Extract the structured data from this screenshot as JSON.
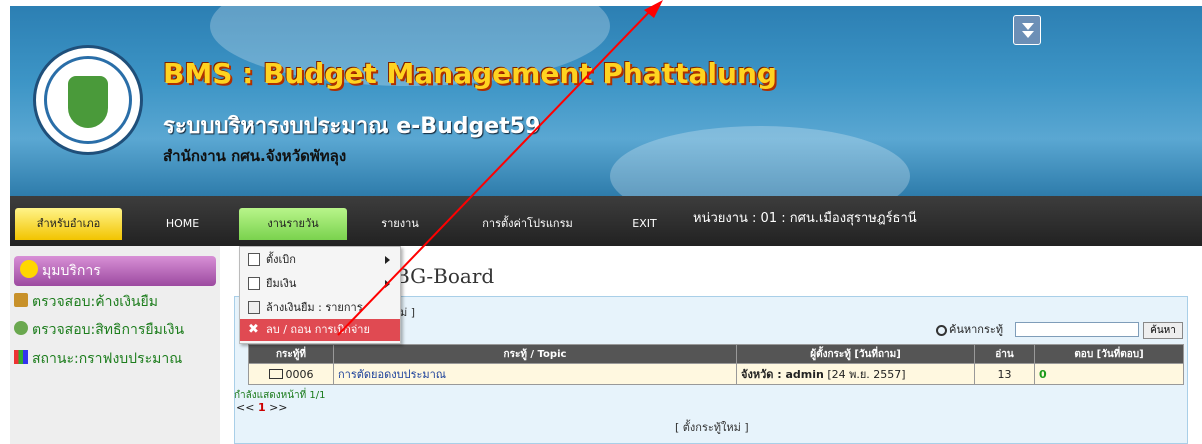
{
  "header": {
    "title_en": "BMS : Budget Management Phattalung",
    "title_th": "ระบบบริหารงบประมาณ e-Budget59",
    "office": "สำนักงาน กศน.จังหวัดพัทลุง",
    "collapse_icon": "double-chevron-down-icon"
  },
  "nav": {
    "items": [
      "สำหรับอำเภอ",
      "HOME",
      "งานรายวัน",
      "รายงาน",
      "การตั้งค่าโปรแกรม",
      "EXIT"
    ],
    "unit_info": "หน่วยงาน : 01 : กศน.เมืองสุราษฎร์ธานี"
  },
  "dropdown": {
    "items": [
      {
        "label": "ตั้งเบิก",
        "icon": "edit-icon",
        "has_submenu": true
      },
      {
        "label": "ยืมเงิน",
        "icon": "document-icon",
        "has_submenu": true
      },
      {
        "label": "ล้างเงินยืม : รายการ",
        "icon": "list-icon",
        "has_submenu": false
      },
      {
        "label": "ลบ / ถอน การเบิกจ่าย",
        "icon": "delete-icon",
        "has_submenu": false
      }
    ]
  },
  "sidebar": {
    "header": "มุมบริการ",
    "items": [
      "ตรวจสอบ:ค้างเงินยืม",
      "ตรวจสอบ:สิทธิการยืมเงิน",
      "สถานะ:กราฟงบประมาณ"
    ]
  },
  "board": {
    "title": "BG-Board",
    "new_topic_top": "ม่ ]",
    "search_label": "ค้นหากระทู้",
    "search_button": "ค้นหา",
    "columns": [
      "กระทู้ที่",
      "กระทู้ / Topic",
      "ผู้ตั้งกระทู้ [วันที่ถาม]",
      "อ่าน",
      "ตอบ [วันที่ตอบ]"
    ],
    "rows": [
      {
        "id": "0006",
        "topic": "การตัดยอดงบประมาณ",
        "author": "จังหวัด : admin",
        "date": "[24 พ.ย. 2557]",
        "reads": "13",
        "replies": "0"
      }
    ],
    "pager_label": "กำลังแสดงหน้าที่ 1/1",
    "pager_prev": "<<",
    "pager_current": "1",
    "pager_next": ">>",
    "new_topic_bottom": "[ ตั้งกระทู้ใหม่ ]"
  },
  "colors": {
    "nav_bg": "#2b2b2b",
    "active_tab": "#f2c400",
    "daily_tab": "#7ad24e",
    "highlight": "#e04a52",
    "annotation": "#ff0000"
  }
}
